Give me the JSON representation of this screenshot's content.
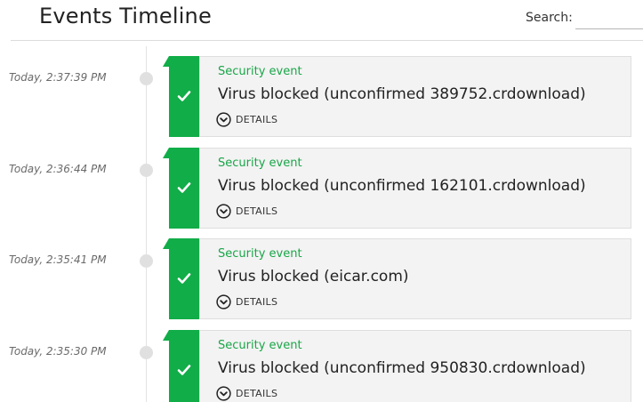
{
  "header": {
    "title": "Events Timeline",
    "search_label": "Search:",
    "search_value": ""
  },
  "events": [
    {
      "time": "Today, 2:37:39 PM",
      "category": "Security event",
      "title": "Virus blocked (unconfirmed 389752.crdownload)",
      "details_label": "DETAILS",
      "status_icon": "check-icon"
    },
    {
      "time": "Today, 2:36:44 PM",
      "category": "Security event",
      "title": "Virus blocked (unconfirmed 162101.crdownload)",
      "details_label": "DETAILS",
      "status_icon": "check-icon"
    },
    {
      "time": "Today, 2:35:41 PM",
      "category": "Security event",
      "title": "Virus blocked (eicar.com)",
      "details_label": "DETAILS",
      "status_icon": "check-icon"
    },
    {
      "time": "Today, 2:35:30 PM",
      "category": "Security event",
      "title": "Virus blocked (unconfirmed 950830.crdownload)",
      "details_label": "DETAILS",
      "status_icon": "check-icon"
    }
  ],
  "colors": {
    "accent_green": "#11ad48",
    "category_text": "#1aa548",
    "card_background": "#f3f3f3",
    "timeline_dot": "#e0e0e0"
  }
}
